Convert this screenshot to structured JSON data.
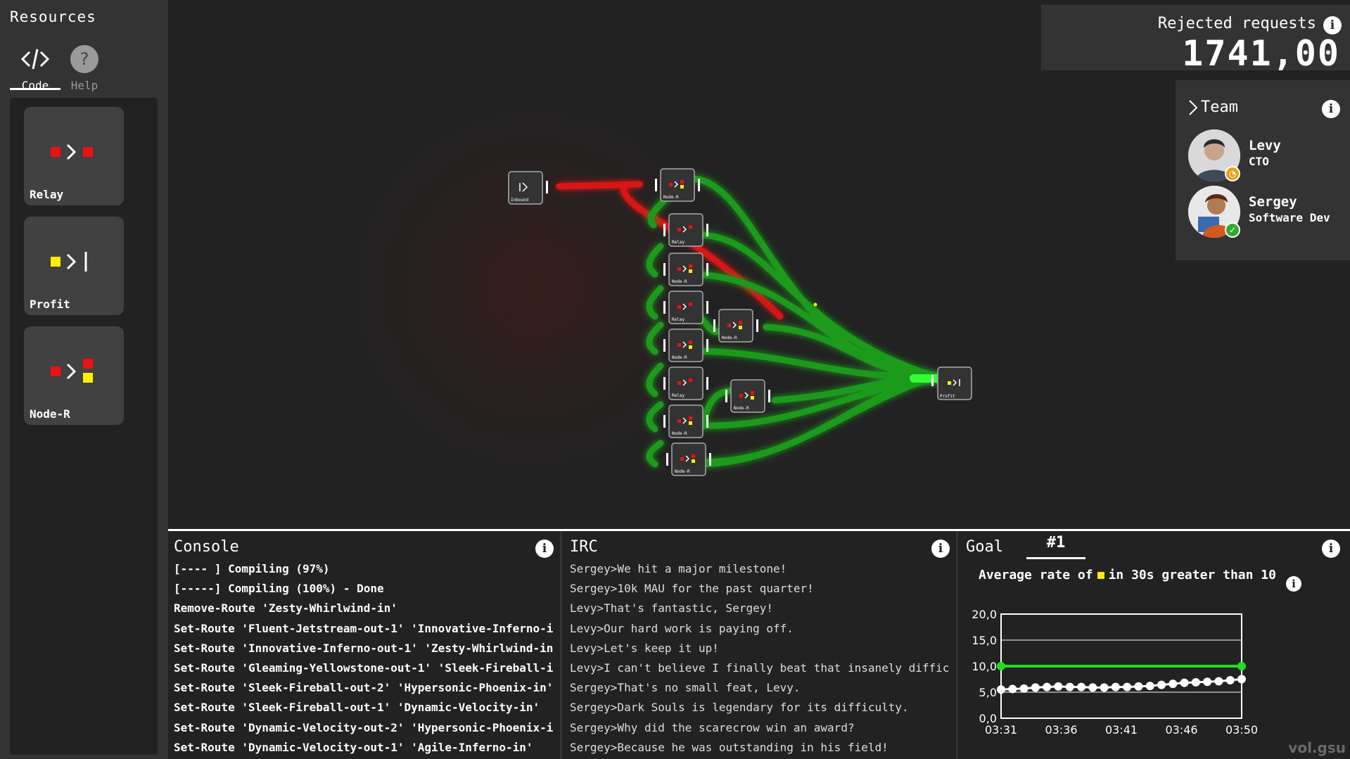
{
  "sidebar": {
    "title": "Resources",
    "tabs": [
      {
        "label": "Code",
        "icon": "code-icon",
        "active": true
      },
      {
        "label": "Help",
        "icon": "help-icon",
        "active": false
      }
    ],
    "resources": [
      {
        "label": "Relay",
        "icon": "relay-icon"
      },
      {
        "label": "Profit",
        "icon": "profit-icon"
      },
      {
        "label": "Node-R",
        "icon": "node-router-icon"
      }
    ]
  },
  "score": {
    "label": "Rejected requests",
    "value": "1741,00"
  },
  "team": {
    "title": "Team",
    "members": [
      {
        "name": "Levy",
        "role": "CTO",
        "status": "away"
      },
      {
        "name": "Sergey",
        "role": "Software Dev",
        "status": "online"
      }
    ]
  },
  "console": {
    "title": "Console",
    "lines": [
      "[---- ] Compiling (97%)",
      "[-----] Compiling (100%) - Done",
      "Remove-Route 'Zesty-Whirlwind-in'",
      "Set-Route 'Fluent-Jetstream-out-1' 'Innovative-Inferno-i",
      "Set-Route 'Innovative-Inferno-out-1' 'Zesty-Whirlwind-in",
      "Set-Route 'Gleaming-Yellowstone-out-1' 'Sleek-Fireball-i",
      "Set-Route 'Sleek-Fireball-out-2' 'Hypersonic-Phoenix-in'",
      "Set-Route 'Sleek-Fireball-out-1' 'Dynamic-Velocity-in'",
      "Set-Route 'Dynamic-Velocity-out-2' 'Hypersonic-Phoenix-i",
      "Set-Route 'Dynamic-Velocity-out-1' 'Agile-Inferno-in'"
    ]
  },
  "irc": {
    "title": "IRC",
    "lines": [
      "Sergey>We hit a major milestone!",
      "Sergey>10k MAU for the past quarter!",
      "Levy>That's fantastic, Sergey!",
      "Levy>Our hard work is paying off.",
      "Levy>Let's keep it up!",
      "Levy>I can't believe I finally beat that insanely diffic",
      "Sergey>That's no small feat, Levy.",
      "Sergey>Dark Souls is legendary for its difficulty.",
      "Sergey>Why did the scarecrow win an award?",
      "Sergey>Because he was outstanding in his field!"
    ]
  },
  "goal": {
    "title": "Goal",
    "tab": "#1",
    "desc_prefix": "Average rate of",
    "desc_suffix": "in 30s greater than 10"
  },
  "colors": {
    "accent_green": "#22dd22",
    "error_red": "#ee1111",
    "profit_yellow": "#ffee00"
  },
  "canvas_nodes": [
    {
      "label": "Inbound"
    },
    {
      "label": "Node-R"
    },
    {
      "label": "Relay"
    },
    {
      "label": "Node-R"
    },
    {
      "label": "Relay"
    },
    {
      "label": "Node-R"
    },
    {
      "label": "Relay"
    },
    {
      "label": "Node-R"
    },
    {
      "label": "Node-R"
    },
    {
      "label": "Node-R"
    },
    {
      "label": "Node-R"
    },
    {
      "label": "Profit"
    }
  ],
  "chart_data": {
    "type": "line",
    "x_ticks": [
      "03:31",
      "03:36",
      "03:41",
      "03:46",
      "03:50"
    ],
    "ylim": [
      0,
      20
    ],
    "y_ticks": [
      "0,0",
      "5,0",
      "10,0",
      "15,0",
      "20,0"
    ],
    "series": [
      {
        "color": "#22dd22",
        "values": [
          10,
          10
        ]
      },
      {
        "color": "#ffffff",
        "values": [
          5.5,
          5.6,
          5.7,
          5.9,
          6.0,
          6.1,
          6.0,
          6.0,
          5.9,
          5.9,
          6.0,
          6.0,
          6.1,
          6.2,
          6.4,
          6.6,
          6.8,
          6.9,
          7.0,
          7.1,
          7.3,
          7.5
        ]
      }
    ]
  },
  "watermark": "vol.gsu"
}
